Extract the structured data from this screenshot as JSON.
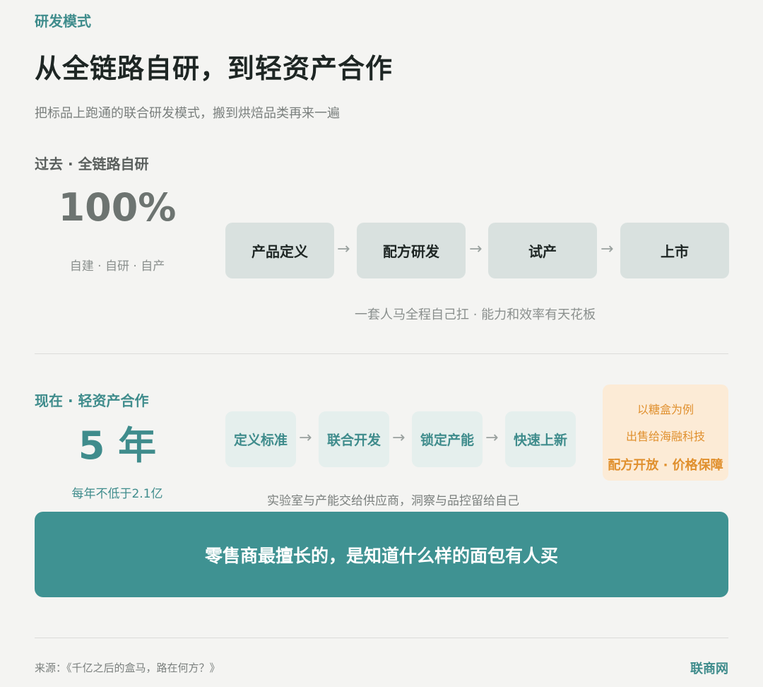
{
  "header": {
    "eyebrow": "研发模式",
    "title": "从全链路自研，到轻资产合作",
    "subtitle": "把标品上跑通的联合研发模式，搬到烘焙品类再来一遍"
  },
  "past": {
    "label": "过去 · 全链路自研",
    "big": "100%",
    "sub": "自建 · 自研 · 自产",
    "steps": [
      "产品定义",
      "配方研发",
      "试产",
      "上市"
    ],
    "note": "一套人马全程自己扛 · 能力和效率有天花板"
  },
  "now": {
    "label": "现在 · 轻资产合作",
    "big": "5 年",
    "sub": "每年不低于2.1亿",
    "steps": [
      "定义标准",
      "联合开发",
      "锁定产能",
      "快速上新"
    ],
    "note": "实验室与产能交给供应商，洞察与品控留给自己",
    "card": {
      "line1": "以糖盒为例",
      "line2": "出售给海融科技",
      "line3": "配方开放 · 价格保障"
    }
  },
  "banner": "零售商最擅长的，是知道什么样的面包有人买",
  "footer": {
    "source": "来源：《千亿之后的盒马，路在何方？》",
    "brand": "联商网"
  },
  "arrow_glyph": "→",
  "colors": {
    "accent": "#3f8c8c",
    "banner": "#3f9292",
    "card_bg": "#fcebd6",
    "card_text": "#e0902e",
    "past_box": "#d9e1df",
    "now_box": "#e5efed"
  }
}
